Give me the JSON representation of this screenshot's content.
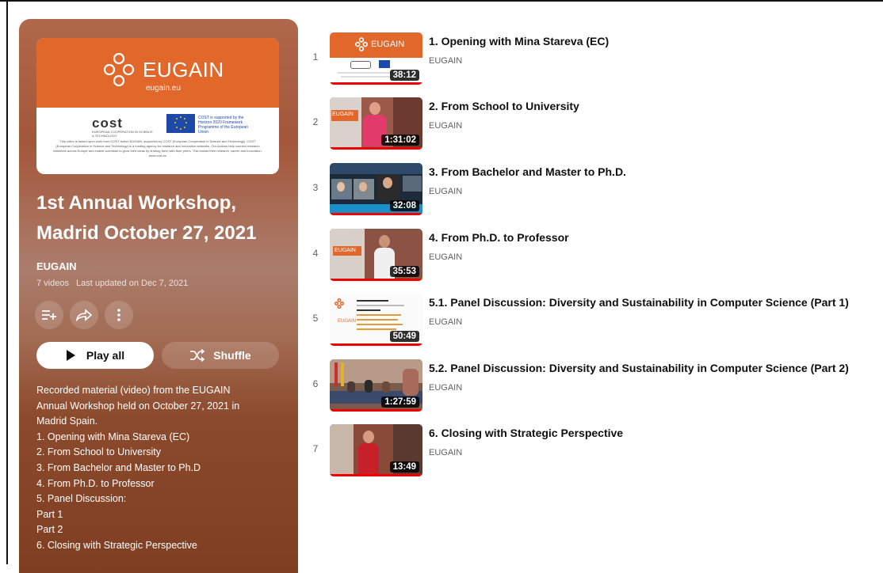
{
  "playlist": {
    "cover": {
      "brand": "EUGAIN",
      "domain": "eugain.eu",
      "cost_logo": "cost",
      "cost_sub": "EUROPEAN COOPERATION IN SCIENCE & TECHNOLOGY",
      "eu_text": "COST is supported by the Horizon 2020 Framework Programme of the European Union",
      "fine_print": "This video is based upon work from COST Action EUGAIN, supported by COST (European Cooperation in Science and Technology). COST (European Cooperation in Science and Technology) is a funding agency for research and innovation networks. Our Actions help connect research initiatives across Europe and enable scientists to grow their ideas by sharing them with their peers. This boosts their research, career and innovation. www.cost.eu"
    },
    "title_line1": "1st Annual Workshop,",
    "title_line2": "Madrid October 27, 2021",
    "owner": "EUGAIN",
    "video_count": "7 videos",
    "last_updated": "Last updated on Dec 7, 2021",
    "play_all_label": "Play all",
    "shuffle_label": "Shuffle",
    "description_lines": [
      "Recorded material (video) from the EUGAIN",
      "Annual Workshop held on October 27, 2021 in",
      "Madrid Spain.",
      "1. Opening with Mina Stareva (EC)",
      "2. From School to University",
      "3. From Bachelor and Master to Ph.D",
      "4. From Ph.D. to Professor",
      "5. Panel Discussion:",
      "Part 1",
      "Part 2",
      "6. Closing with Strategic Perspective"
    ],
    "icons": [
      "add-to-queue-icon",
      "share-icon",
      "more-icon",
      "play-icon",
      "shuffle-icon"
    ]
  },
  "videos": [
    {
      "index": "1",
      "title": "1. Opening with Mina Stareva (EC)",
      "channel": "EUGAIN",
      "duration": "38:12",
      "thumb_text": "EUGAIN"
    },
    {
      "index": "2",
      "title": "2. From School to University",
      "channel": "EUGAIN",
      "duration": "1:31:02",
      "thumb_text": "EUGAIN"
    },
    {
      "index": "3",
      "title": "3. From Bachelor and Master to Ph.D.",
      "channel": "EUGAIN",
      "duration": "32:08"
    },
    {
      "index": "4",
      "title": "4. From Ph.D. to Professor",
      "channel": "EUGAIN",
      "duration": "35:53",
      "thumb_text": "EUGAIN"
    },
    {
      "index": "5",
      "title": "5.1. Panel Discussion: Diversity and Sustainability in Computer Science (Part 1)",
      "channel": "EUGAIN",
      "duration": "50:49",
      "thumb_text": "EUGAIN"
    },
    {
      "index": "6",
      "title": "5.2. Panel Discussion: Diversity and Sustainability in Computer Science (Part 2)",
      "channel": "EUGAIN",
      "duration": "1:27:59"
    },
    {
      "index": "7",
      "title": "6. Closing with Strategic Perspective",
      "channel": "EUGAIN",
      "duration": "13:49"
    }
  ],
  "colors": {
    "brand_orange": "#e2672a",
    "progress_red": "#ee0000",
    "panel_brown": "#7e3e22"
  }
}
